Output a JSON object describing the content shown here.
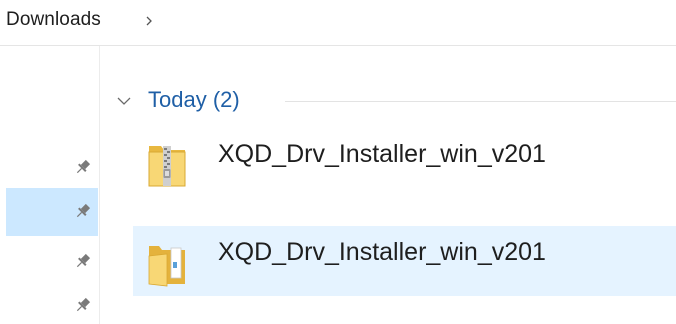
{
  "breadcrumb": {
    "items": [
      {
        "label": "Downloads"
      }
    ],
    "separator_icon": "chevron-right-icon"
  },
  "nav_pane": {
    "pins": [
      {
        "icon": "pin-icon",
        "selected": false
      },
      {
        "icon": "pin-icon",
        "selected": true
      },
      {
        "icon": "pin-icon",
        "selected": false
      },
      {
        "icon": "pin-icon",
        "selected": false
      }
    ]
  },
  "content": {
    "group": {
      "title": "Today (2)",
      "expanded": true
    },
    "files": [
      {
        "name": "XQD_Drv_Installer_win_v201",
        "icon": "zip-folder-icon",
        "selected": false
      },
      {
        "name": "XQD_Drv_Installer_win_v201",
        "icon": "folder-icon",
        "selected": true
      }
    ]
  },
  "colors": {
    "group_title": "#1f5fa6",
    "selected_row": "#e5f3ff",
    "nav_selected": "#cce8ff",
    "folder_yellow": "#f8d775"
  }
}
